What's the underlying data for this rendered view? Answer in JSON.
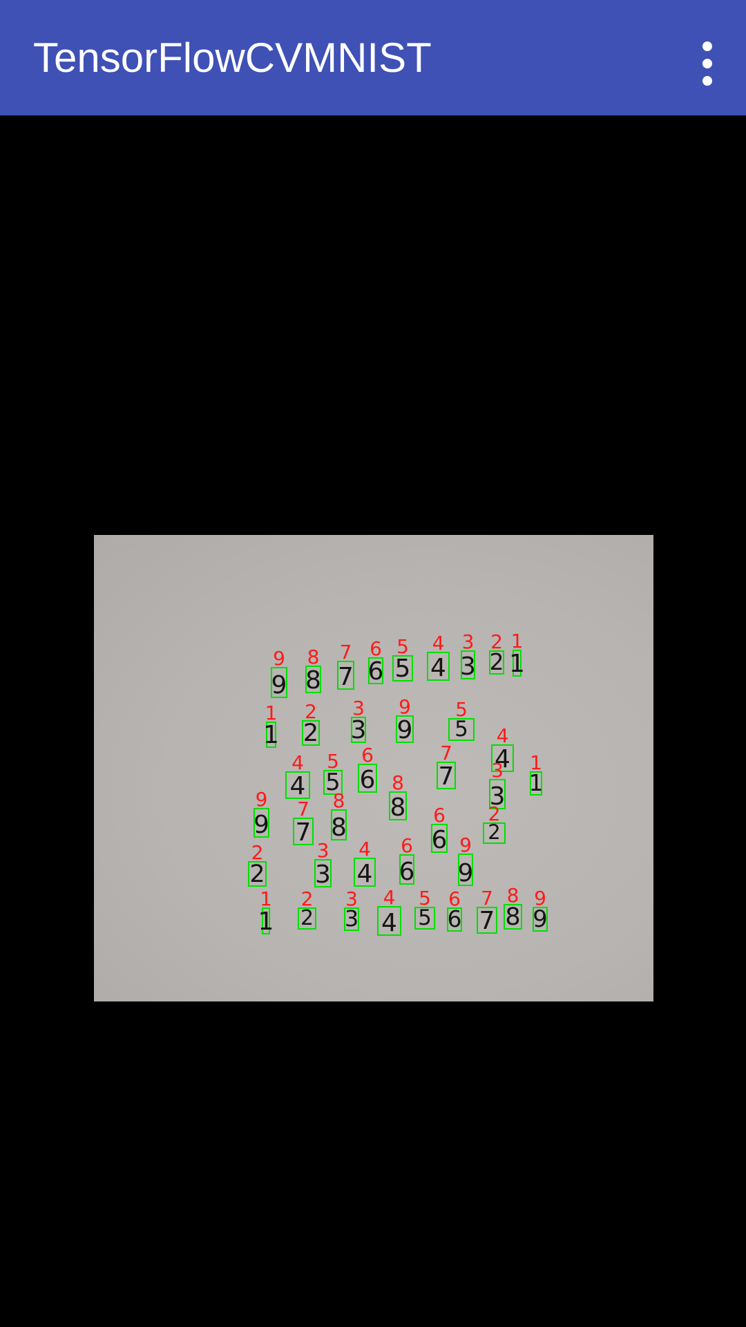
{
  "app_bar": {
    "title": "TensorFlowCVMNIST",
    "overflow_icon": "more-vert-icon",
    "color": "#3f51b5"
  },
  "camera_preview": {
    "box_color": "#00e000",
    "label_color": "#ff1a1a",
    "detections": [
      "9",
      "8",
      "7",
      "6",
      "5",
      "4",
      "3",
      "2",
      "1",
      "1",
      "2",
      "3",
      "9",
      "5",
      "4",
      "4",
      "5",
      "6",
      "7",
      "1",
      "3",
      "9",
      "7",
      "8",
      "8",
      "6",
      "2",
      "2",
      "3",
      "4",
      "6",
      "9",
      "1",
      "2",
      "3",
      "4",
      "5",
      "6",
      "7",
      "8",
      "9"
    ]
  }
}
